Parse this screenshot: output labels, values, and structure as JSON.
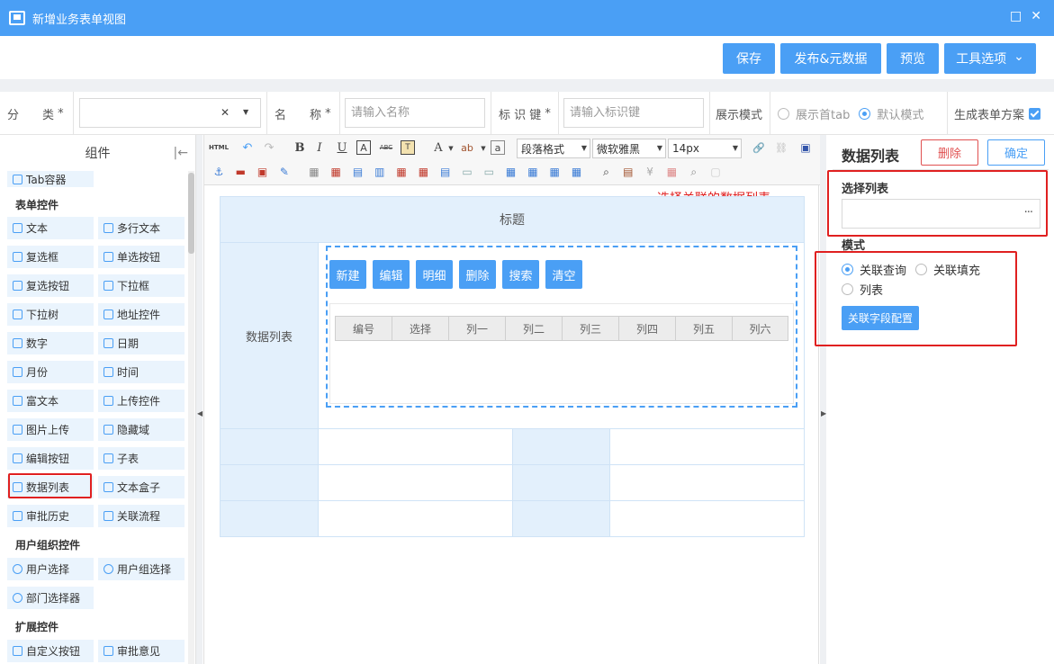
{
  "window": {
    "title": "新增业务表单视图",
    "max_glyph": "□",
    "close_glyph": "✕"
  },
  "toolbar": {
    "save": "保存",
    "publish": "发布&元数据",
    "preview": "预览",
    "tools": "工具选项",
    "tools_caret": "⌄"
  },
  "form": {
    "category_label": "分　　类",
    "name_label": "名　　称",
    "name_placeholder": "请输入名称",
    "key_label": "标 识 键",
    "key_placeholder": "请输入标识键",
    "required_mark": "*",
    "clear_glyph": "✕",
    "caret": "▼",
    "display_mode_label": "展示模式",
    "mode_first_tab": "展示首tab",
    "mode_default": "默认模式",
    "gen_plan_label": "生成表单方案"
  },
  "left": {
    "title": "组件",
    "collapse_glyph": "|←",
    "partial_item": "Tab容器",
    "sections": {
      "form_controls": "表单控件",
      "user_org": "用户组织控件",
      "extended": "扩展控件"
    },
    "items": [
      "文本",
      "多行文本",
      "复选框",
      "单选按钮",
      "复选按钮",
      "下拉框",
      "下拉树",
      "地址控件",
      "数字",
      "日期",
      "月份",
      "时间",
      "富文本",
      "上传控件",
      "图片上传",
      "隐藏域",
      "编辑按钮",
      "子表",
      "数据列表",
      "文本盒子",
      "审批历史",
      "关联流程"
    ],
    "user_items": [
      "用户选择",
      "用户组选择",
      "部门选择器"
    ],
    "ext_items": [
      "自定义按钮",
      "审批意见"
    ]
  },
  "editor": {
    "html_btn": "HTML",
    "para_format": "段落格式",
    "font_family": "微软雅黑",
    "font_size": "14px",
    "annotation": "选择关联的数据列表",
    "title_cell": "标题",
    "row_label": "数据列表",
    "actions": [
      "新建",
      "编辑",
      "明细",
      "删除",
      "搜索",
      "清空"
    ],
    "columns": [
      "编号",
      "选择",
      "列一",
      "列二",
      "列三",
      "列四",
      "列五",
      "列六"
    ],
    "glyphs": {
      "undo": "↶",
      "redo": "↷",
      "bold": "B",
      "italic": "I",
      "underline": "U",
      "font_color": "A",
      "abc": "ABC",
      "caret": "▼",
      "link": "🔗"
    }
  },
  "right": {
    "title": "数据列表",
    "delete": "删除",
    "confirm": "确定",
    "select_list_label": "选择列表",
    "more_glyph": "···",
    "mode_label": "模式",
    "mode_query": "关联查询",
    "mode_fill": "关联填充",
    "mode_list": "列表",
    "config_btn": "关联字段配置"
  },
  "colors": {
    "primary": "#4a9ff5",
    "red": "#e02020",
    "header_fill": "#e3f0fc"
  }
}
